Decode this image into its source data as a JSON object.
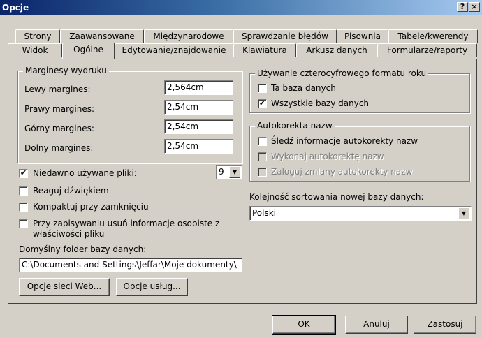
{
  "window": {
    "title": "Opcje",
    "help_button": "?",
    "close_button": "×"
  },
  "tabs": {
    "row1": [
      "Strony",
      "Zaawansowane",
      "Międzynarodowe",
      "Sprawdzanie błędów",
      "Pisownia",
      "Tabele/kwerendy"
    ],
    "row2": [
      "Widok",
      "Ogólne",
      "Edytowanie/znajdowanie",
      "Klawiatura",
      "Arkusz danych",
      "Formularze/raporty"
    ],
    "active": "Ogólne"
  },
  "margins": {
    "legend": "Marginesy wydruku",
    "left_label": "Lewy margines:",
    "left_value": "2,564cm",
    "right_label": "Prawy margines:",
    "right_value": "2,54cm",
    "top_label": "Górny margines:",
    "top_value": "2,54cm",
    "bottom_label": "Dolny margines:",
    "bottom_value": "2,54cm"
  },
  "recent_files": {
    "label": "Niedawno używane pliki:",
    "checked": true,
    "check_mark": "✔",
    "count": "9",
    "arrow": "▼"
  },
  "options": {
    "sound_label": "Reaguj dźwiękiem",
    "compact_label": "Kompaktuj przy zamknięciu",
    "remove_info_line1": "Przy zapisywaniu usuń informacje osobiste z",
    "remove_info_line2": "właściwości pliku"
  },
  "default_folder": {
    "label": "Domyślny folder bazy danych:",
    "value": "C:\\Documents and Settings\\Jeffar\\Moje dokumenty\\"
  },
  "buttons": {
    "web_options": "Opcje sieci Web...",
    "service_options": "Opcje usług...",
    "ok": "OK",
    "cancel": "Anuluj",
    "apply": "Zastosuj"
  },
  "year_format": {
    "legend": "Używanie czterocyfrowego formatu roku",
    "this_db_label": "Ta baza danych",
    "this_db_checked": false,
    "all_db_label": "Wszystkie bazy danych",
    "all_db_checked": true,
    "check_mark": "✔"
  },
  "autocorrect": {
    "legend": "Autokorekta nazw",
    "track_label": "Śledź informacje autokorekty nazw",
    "perform_label": "Wykonaj autokorektę nazw",
    "log_label": "Zaloguj zmiany autokorekty nazw"
  },
  "sort_order": {
    "label": "Kolejność sortowania nowej bazy danych:",
    "value": "Polski",
    "arrow": "▼"
  }
}
